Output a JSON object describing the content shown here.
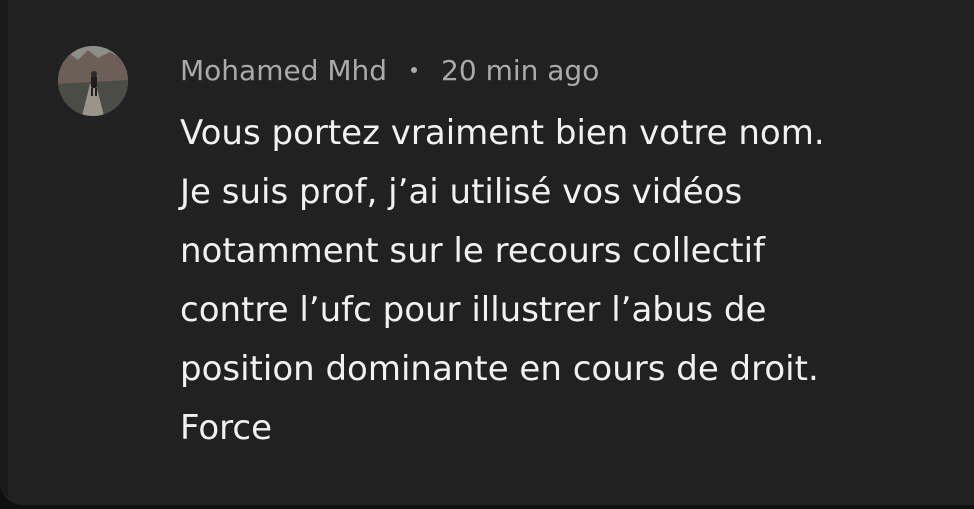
{
  "comment": {
    "author": "Mohamed Mhd",
    "time": "20 min ago",
    "lines": [
      "Vous portez vraiment bien votre nom.",
      "Je suis prof, j’ai utilisé vos vidéos",
      "notamment sur le recours collectif",
      "contre l’ufc pour illustrer l’abus de",
      "position dominante en cours de droit.",
      "Force"
    ]
  },
  "colors": {
    "background": "#212121",
    "text_primary": "#f1f1f1",
    "text_secondary": "#aaaaaa"
  }
}
